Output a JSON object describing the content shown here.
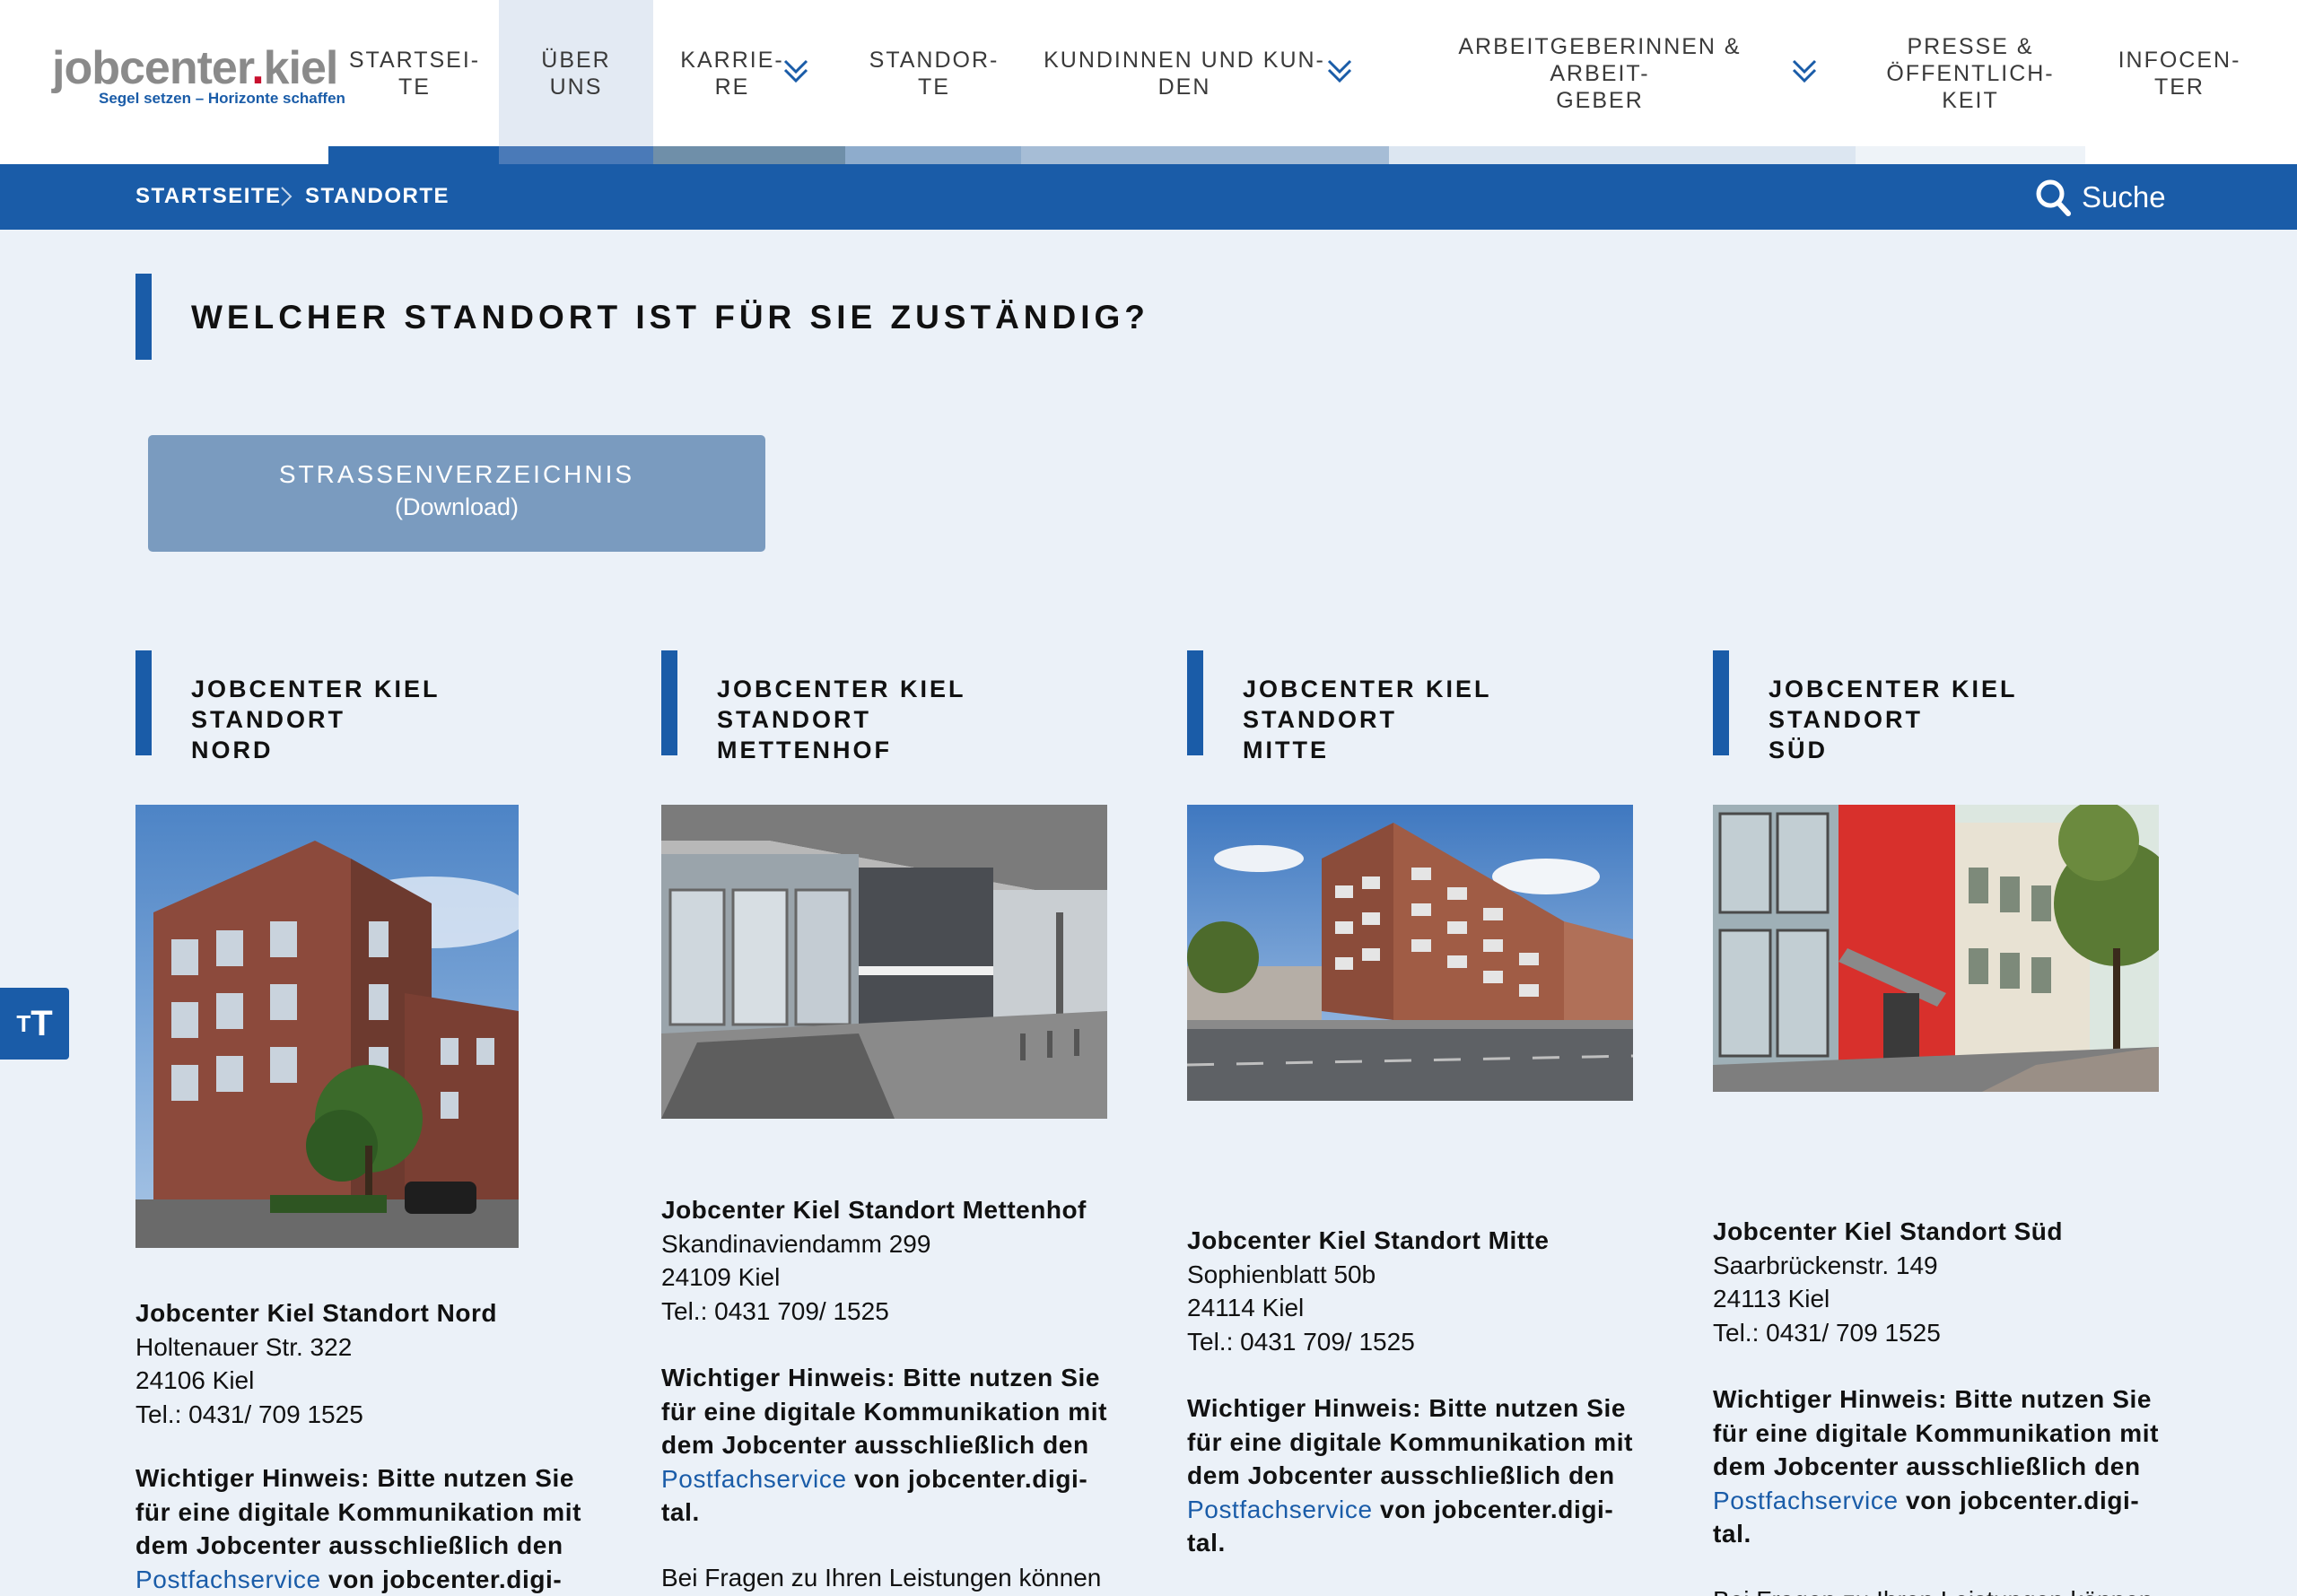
{
  "logo": {
    "brand_main": "jobcenter",
    "brand_dot": ".",
    "brand_city": "kiel",
    "slogan": "Segel setzen – Horizonte schaffen"
  },
  "nav": [
    {
      "label": "STARTSEI-\nTE"
    },
    {
      "label": "ÜBER\nUNS"
    },
    {
      "label": "KARRIE-\nRE"
    },
    {
      "label": "STANDOR-\nTE"
    },
    {
      "label": "KUNDINNEN UND KUN-\nDEN"
    },
    {
      "label": "ARBEITGEBERINNEN & ARBEIT-\nGEBER"
    },
    {
      "label": "PRESSE &\nÖFFENTLICH-\nKEIT"
    },
    {
      "label": "INFOCEN-\nTER"
    }
  ],
  "colors": {
    "primary": "#1a5ca8",
    "background": "#ebf1f8",
    "button": "#7a9bbf",
    "nav_active": "#e3eaf3"
  },
  "breadcrumb": {
    "items": [
      "STARTSEITE",
      "STANDORTE"
    ]
  },
  "search": {
    "label": "Suche"
  },
  "page": {
    "title": "WELCHER STANDORT IST FÜR SIE ZUSTÄNDIG?",
    "street_button": {
      "line1": "STRASSENVERZEICHNIS",
      "line2": "(Download)"
    }
  },
  "locations": [
    {
      "heading": "JOBCENTER KIEL STANDORT\nNORD",
      "name": "Jobcenter Kiel Standort Nord",
      "street": "Holtenauer Str. 322",
      "city": "24106 Kiel",
      "phone": "Tel.: 0431/ 709 1525",
      "notice_before": "Wichtiger Hinweis: Bitte nutzen Sie für eine digitale Kommunikation mit dem Jobcenter ausschließlich den",
      "notice_link": "Postfachservice",
      "notice_after": "von jobcenter.digi-"
    },
    {
      "heading": "JOBCENTER KIEL STANDORT\nMETTENHOF",
      "name": "Jobcenter Kiel Standort Mettenhof",
      "street": "Skandinaviendamm 299",
      "city": "24109 Kiel",
      "phone": "Tel.: 0431 709/ 1525",
      "notice_before": "Wichtiger Hinweis: Bitte nutzen Sie für eine digitale Kommunikation mit dem Jobcenter ausschließlich den",
      "notice_link": "Postfachservice",
      "notice_after": "von jobcenter.digi-tal.",
      "more": "Bei Fragen zu Ihren Leistungen können"
    },
    {
      "heading": "JOBCENTER KIEL STANDORT\nMITTE",
      "name": "Jobcenter Kiel Standort Mitte",
      "street": "Sophienblatt 50b",
      "city": "24114 Kiel",
      "phone": "Tel.: 0431 709/ 1525",
      "notice_before": "Wichtiger Hinweis: Bitte nutzen Sie für eine digitale Kommunikation mit dem Jobcenter ausschließlich den",
      "notice_link": "Postfachservice",
      "notice_after": "von jobcenter.digi-tal."
    },
    {
      "heading": "JOBCENTER KIEL STANDORT\nSÜD",
      "name": "Jobcenter Kiel Standort Süd",
      "street": "Saarbrückenstr. 149",
      "city": "24113 Kiel",
      "phone": "Tel.: 0431/ 709 1525",
      "notice_before": "Wichtiger Hinweis: Bitte nutzen Sie für eine digitale Kommunikation mit dem Jobcenter ausschließlich den",
      "notice_link": "Postfachservice",
      "notice_after": "von jobcenter.digi-tal.",
      "more": "Bei Fragen zu Ihren Leistungen können"
    }
  ],
  "fontsize_button": {
    "big": "T",
    "small": "T"
  }
}
